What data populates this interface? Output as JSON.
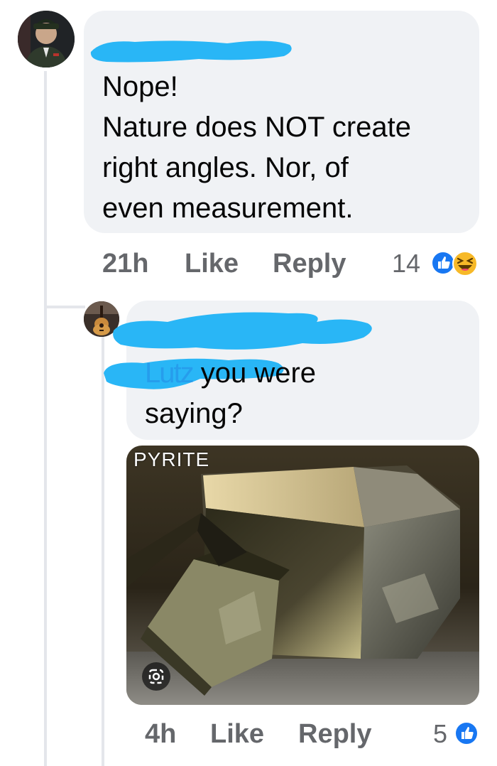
{
  "comment": {
    "text": "Nope!\nNature does NOT create\nright angles. Nor, of\neven measurement.",
    "time": "21h",
    "like_label": "Like",
    "reply_label": "Reply",
    "reaction_count": "14",
    "reactions": [
      "like-icon",
      "haha-icon"
    ]
  },
  "reply": {
    "mention_visible": "Lutz",
    "text": " you were\nsaying?",
    "attachment_label": "PYRITE",
    "time": "4h",
    "like_label": "Like",
    "reply_label": "Reply",
    "reaction_count": "5",
    "reactions": [
      "like-icon"
    ]
  },
  "colors": {
    "bubble": "#f0f2f5",
    "meta_gray": "#65676b",
    "redaction_blue": "#29b6f6",
    "mention_blue": "#216fdb",
    "like_blue": "#1877f2",
    "haha_yellow": "#f7b928"
  }
}
